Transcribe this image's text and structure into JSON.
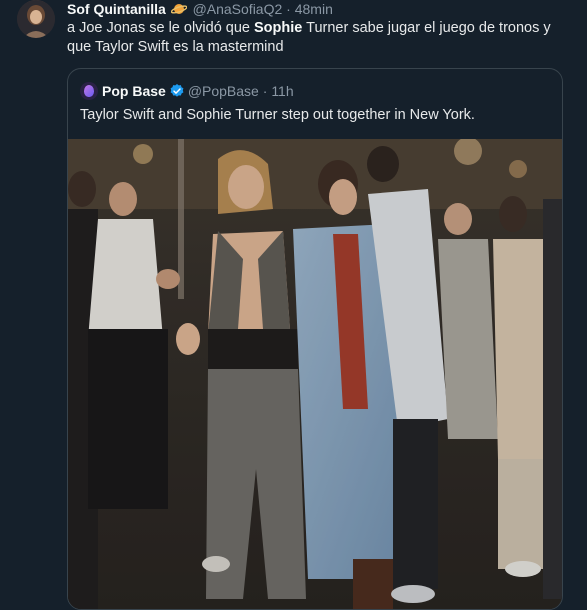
{
  "tweet": {
    "author_name": "Sof Quintanilla",
    "author_emoji_icon": "ringed-planet-icon",
    "handle": "@AnaSofiaQ2",
    "separator": "·",
    "time": "48min",
    "text_before": "a Joe Jonas se le olvidó que ",
    "text_bold": "Sophie",
    "text_after": " Turner sabe jugar el juego de tronos y que Taylor Swift es la mastermind"
  },
  "quoted": {
    "author_name": "Pop Base",
    "verified_icon": "verified-badge-icon",
    "handle": "@PopBase",
    "separator": "·",
    "time": "11h",
    "text": "Taylor Swift and Sophie Turner step out together in New York."
  },
  "colors": {
    "background": "#15202b",
    "border": "#38444d",
    "secondary_text": "#8b98a5",
    "verified_blue": "#1d9bf0"
  }
}
